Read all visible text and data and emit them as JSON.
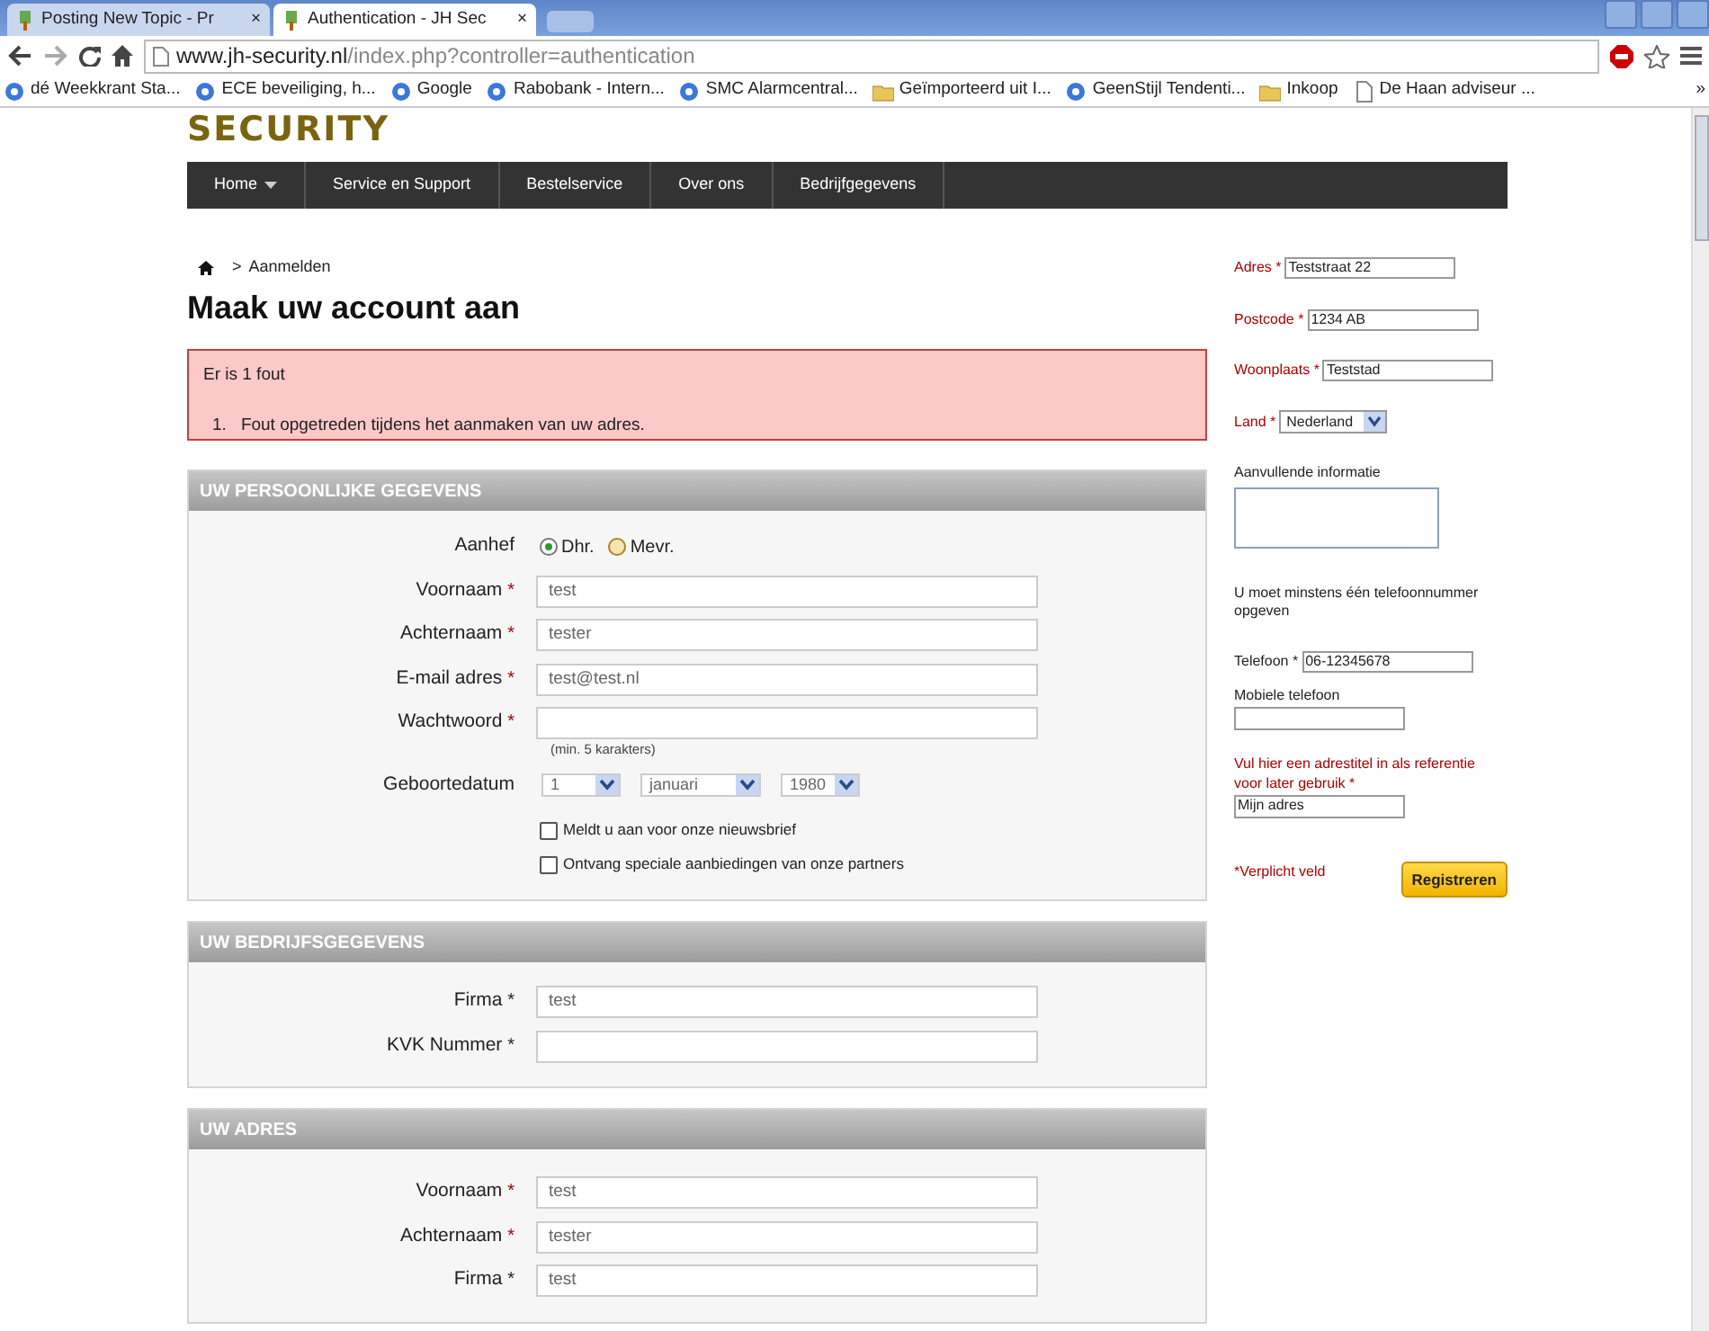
{
  "browser": {
    "tabs": [
      {
        "title": "Posting New Topic - Pr",
        "selected": false,
        "close": "×"
      },
      {
        "title": "Authentication - JH Sec",
        "selected": true,
        "close": "×"
      }
    ],
    "address": {
      "host": "www.jh-security.nl",
      "path": "/index.php?controller=authentication"
    },
    "bookmarks": [
      {
        "label": "dé Weekkrant Sta..."
      },
      {
        "label": "ECE beveiliging, h..."
      },
      {
        "label": "Google"
      },
      {
        "label": "Rabobank - Intern..."
      },
      {
        "label": "SMC Alarmcentral..."
      },
      {
        "label": "Geïmporteerd uit I..."
      },
      {
        "label": "GeenStijl Tendenti..."
      },
      {
        "label": "Inkoop"
      },
      {
        "label": "De Haan adviseur ..."
      }
    ],
    "more": "»"
  },
  "site": {
    "logo": "SECURITY",
    "nav": [
      {
        "label": "Home",
        "dropdown": true
      },
      {
        "label": "Service en Support",
        "dropdown": false
      },
      {
        "label": "Bestelservice",
        "dropdown": false
      },
      {
        "label": "Over ons",
        "dropdown": false
      },
      {
        "label": "Bedrijfgegevens",
        "dropdown": false
      }
    ],
    "breadcrumb": {
      "separator": ">",
      "current": "Aanmelden"
    },
    "heading": "Maak uw account aan",
    "error": {
      "title": "Er is 1 fout",
      "items": [
        {
          "number": "1.",
          "text": "Fout opgetreden tijdens het aanmaken van uw adres."
        }
      ]
    },
    "sections": [
      {
        "title": "UW PERSOONLIJKE GEGEVENS",
        "fields": [
          {
            "kind": "radio",
            "label": "Aanhef",
            "options": [
              {
                "label": "Dhr.",
                "selected": true
              },
              {
                "label": "Mevr.",
                "selected": false
              }
            ]
          },
          {
            "kind": "text",
            "label": "Voornaam",
            "marker": "*",
            "marker_red": true,
            "value": "test"
          },
          {
            "kind": "text",
            "label": "Achternaam",
            "marker": "*",
            "marker_red": true,
            "value": "tester"
          },
          {
            "kind": "text",
            "label": "E-mail adres",
            "marker": "*",
            "marker_red": true,
            "value": "test@test.nl"
          },
          {
            "kind": "text",
            "label": "Wachtwoord",
            "marker": "*",
            "marker_red": true,
            "hint": "(min. 5 karakters)"
          },
          {
            "kind": "selects",
            "label": "Geboortedatum",
            "options": [
              "1",
              "januari",
              "1980"
            ]
          },
          {
            "kind": "checkbox",
            "label": "Meldt u aan voor onze nieuwsbrief",
            "checked": false
          },
          {
            "kind": "checkbox",
            "label": "Ontvang speciale aanbiedingen van onze partners",
            "checked": false
          }
        ]
      },
      {
        "title": "UW BEDRIJFSGEGEVENS",
        "fields": [
          {
            "kind": "text",
            "label": "Firma",
            "marker": "*",
            "marker_red": false,
            "value": "test"
          },
          {
            "kind": "text",
            "label": "KVK Nummer",
            "marker": "*",
            "marker_red": false
          }
        ]
      },
      {
        "title": "UW ADRES",
        "fields": [
          {
            "kind": "text",
            "label": "Voornaam",
            "marker": "*",
            "marker_red": true,
            "value": "test"
          },
          {
            "kind": "text",
            "label": "Achternaam",
            "marker": "*",
            "marker_red": true,
            "value": "tester"
          },
          {
            "kind": "text",
            "label": "Firma",
            "marker": "*",
            "marker_red": false,
            "value": "test"
          }
        ]
      }
    ],
    "sidebar": [
      {
        "kind": "inline",
        "label": "Adres *",
        "red": true,
        "value": "Teststraat 22"
      },
      {
        "kind": "inline",
        "label": "Postcode *",
        "red": true,
        "value": "1234 AB"
      },
      {
        "kind": "inline",
        "label": "Woonplaats *",
        "red": true,
        "value": "Teststad"
      },
      {
        "kind": "select",
        "label": "Land *",
        "red": true,
        "value": "Nederland"
      },
      {
        "kind": "textarea",
        "label": "Aanvullende informatie",
        "red": false
      },
      {
        "kind": "note",
        "text": "U moet minstens één telefoonnummer opgeven",
        "red": false
      },
      {
        "kind": "inline",
        "label": "Telefoon *",
        "red": false,
        "value": "06-12345678"
      },
      {
        "kind": "stacked",
        "label": "Mobiele telefoon",
        "red": false
      },
      {
        "kind": "stacked",
        "label": "Vul hier een adrestitel in als referentie voor later gebruik *",
        "red": true,
        "value": "Mijn adres"
      }
    ],
    "required_note": "*Verplicht veld",
    "submit": "Registreren"
  }
}
